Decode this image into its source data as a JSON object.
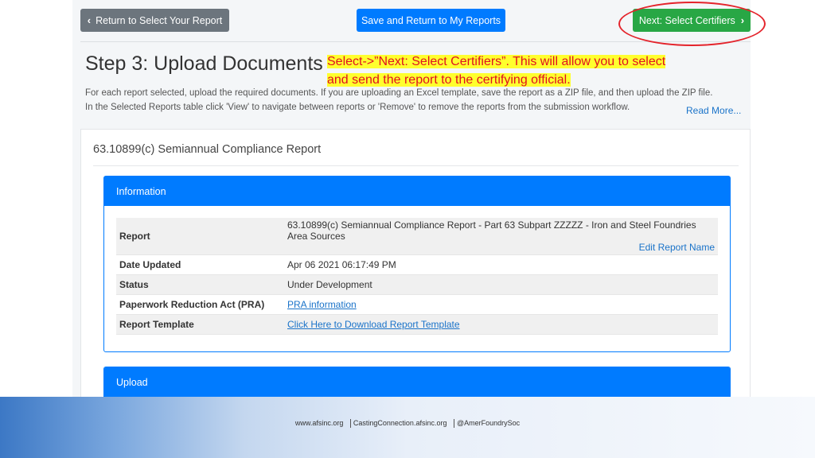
{
  "toolbar": {
    "back_label": "Return to Select Your Report",
    "save_label": "Save and Return to My Reports",
    "next_label": "Next: Select Certifiers"
  },
  "page": {
    "title": "Step 3: Upload Documents",
    "description_line1": "For each report selected, upload the required documents. If you are uploading an Excel template, save the report as a ZIP file, and then upload the ZIP file.",
    "description_line2": "In the Selected Reports table click 'View' to navigate between reports or 'Remove' to remove the reports from the submission workflow.",
    "read_more": "Read More..."
  },
  "callout": {
    "line1": "Select->”Next: Select Certifiers”.  This will allow you to select",
    "line2": "and send the report to the certifying official."
  },
  "report": {
    "title": "63.10899(c) Semiannual Compliance Report"
  },
  "information": {
    "header": "Information",
    "rows": [
      {
        "label": "Report",
        "value": "63.10899(c) Semiannual Compliance Report - Part 63 Subpart ZZZZZ - Iron and Steel Foundries Area Sources",
        "link": "Edit Report Name"
      },
      {
        "label": "Date Updated",
        "value": "Apr 06 2021 06:17:49 PM"
      },
      {
        "label": "Status",
        "value": "Under Development"
      },
      {
        "label": "Paperwork Reduction Act (PRA)",
        "value": "PRA information"
      },
      {
        "label": "Report Template",
        "value": "Click Here to Download Report Template"
      }
    ]
  },
  "upload": {
    "header": "Upload"
  },
  "footer": {
    "site1": "www.afsinc.org",
    "site2": "CastingConnection.afsinc.org",
    "social": "@AmerFoundrySoc"
  },
  "colors": {
    "primary": "#007bff",
    "success": "#28a745",
    "secondary": "#6c757d",
    "callout_text": "#e0101f",
    "callout_highlight": "#ffff2e",
    "annotation_circle": "#e4232b"
  }
}
